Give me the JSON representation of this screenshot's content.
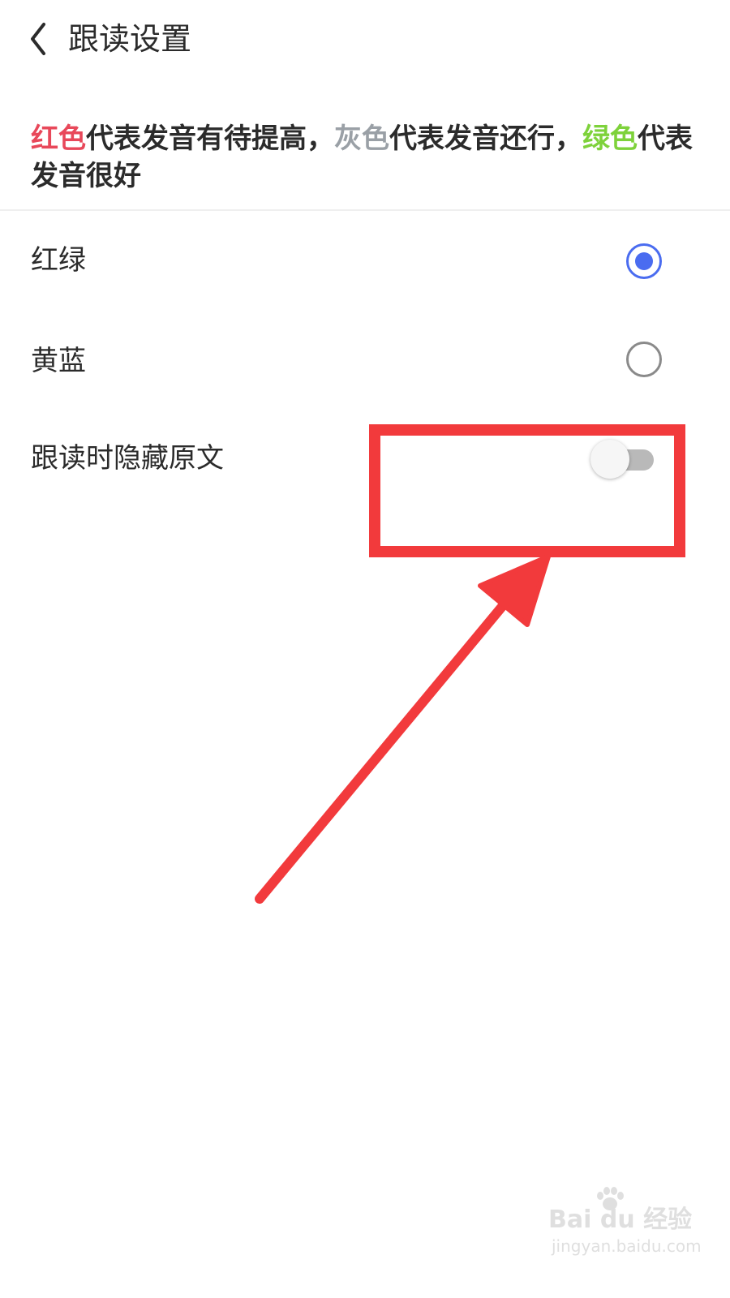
{
  "header": {
    "title": "跟读设置",
    "back_icon": "chevron-left-icon"
  },
  "legend": {
    "red_label": "红色",
    "red_text": "代表发音有待提高，",
    "gray_label": "灰色",
    "gray_text": "代表发音还行，",
    "green_label": "绿色",
    "green_text": "代表发音很好"
  },
  "options": [
    {
      "label": "红绿",
      "selected": true
    },
    {
      "label": "黄蓝",
      "selected": false
    }
  ],
  "toggle": {
    "label": "跟读时隐藏原文",
    "on": false
  },
  "watermark": {
    "brand": "Bai du 经验",
    "url": "jingyan.baidu.com"
  },
  "colors": {
    "red": "#e8485a",
    "gray": "#9aa0a6",
    "green": "#7ed23b",
    "radio_accent": "#4a6cf0",
    "annotation": "#f23a3c"
  }
}
